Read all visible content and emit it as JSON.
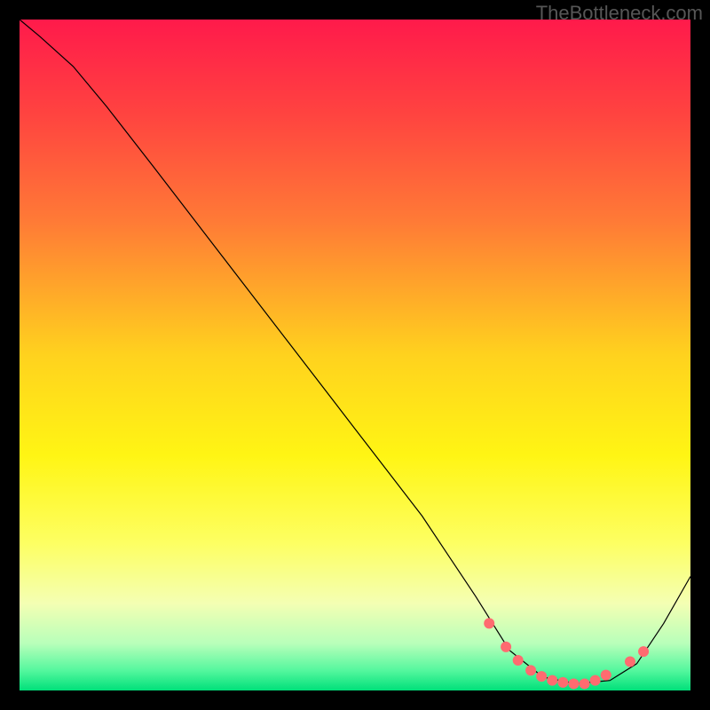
{
  "attribution": "TheBottleneck.com",
  "chart_data": {
    "type": "line",
    "title": "",
    "xlabel": "",
    "ylabel": "",
    "xlim": [
      0,
      100
    ],
    "ylim": [
      0,
      100
    ],
    "axes_visible": false,
    "background": {
      "type": "vertical-gradient",
      "stops": [
        {
          "pos": 0.0,
          "color": "#ff1a4b"
        },
        {
          "pos": 0.14,
          "color": "#ff4340"
        },
        {
          "pos": 0.3,
          "color": "#ff7a36"
        },
        {
          "pos": 0.5,
          "color": "#ffd21e"
        },
        {
          "pos": 0.65,
          "color": "#fff514"
        },
        {
          "pos": 0.78,
          "color": "#fdff62"
        },
        {
          "pos": 0.87,
          "color": "#f4ffb3"
        },
        {
          "pos": 0.93,
          "color": "#b8ffba"
        },
        {
          "pos": 0.97,
          "color": "#55f79e"
        },
        {
          "pos": 1.0,
          "color": "#00e07a"
        }
      ]
    },
    "frame_color": "#000000",
    "series": [
      {
        "name": "curve",
        "color": "#000000",
        "stroke_width": 1.2,
        "x": [
          0.0,
          3.0,
          8.0,
          13.0,
          20.0,
          30.0,
          40.0,
          50.0,
          60.0,
          68.0,
          73.0,
          78.0,
          83.0,
          88.0,
          92.0,
          96.0,
          100.0
        ],
        "y": [
          100.0,
          97.5,
          93.0,
          87.0,
          78.0,
          65.0,
          52.0,
          39.0,
          26.0,
          14.0,
          6.0,
          2.0,
          1.0,
          1.5,
          4.0,
          10.0,
          17.0
        ]
      }
    ],
    "markers": {
      "name": "valley-markers",
      "color": "#ff6b70",
      "radius": 6,
      "points": [
        {
          "x": 70.0,
          "y": 10.0
        },
        {
          "x": 72.5,
          "y": 6.5
        },
        {
          "x": 74.3,
          "y": 4.5
        },
        {
          "x": 76.2,
          "y": 3.0
        },
        {
          "x": 77.8,
          "y": 2.1
        },
        {
          "x": 79.4,
          "y": 1.5
        },
        {
          "x": 81.0,
          "y": 1.2
        },
        {
          "x": 82.6,
          "y": 1.0
        },
        {
          "x": 84.2,
          "y": 1.0
        },
        {
          "x": 85.8,
          "y": 1.5
        },
        {
          "x": 87.4,
          "y": 2.3
        },
        {
          "x": 91.0,
          "y": 4.3
        },
        {
          "x": 93.0,
          "y": 5.8
        }
      ]
    }
  }
}
